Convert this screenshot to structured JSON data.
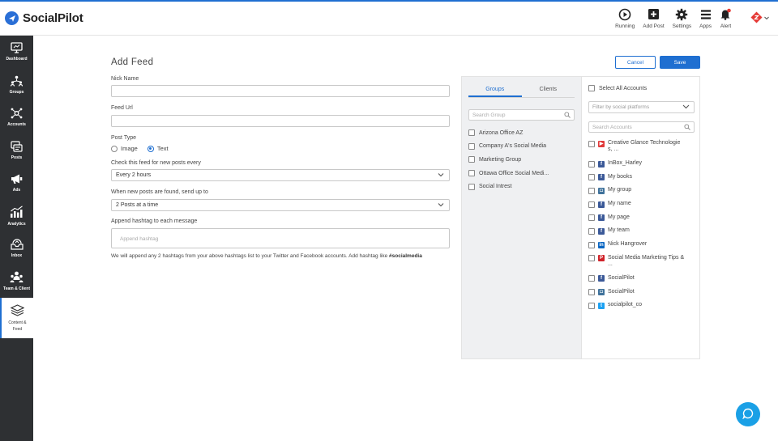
{
  "app": {
    "name": "SocialPilot"
  },
  "topbar": {
    "actions": [
      {
        "label": "Running",
        "icon": "play-icon"
      },
      {
        "label": "Add Post",
        "icon": "add-post-icon"
      },
      {
        "label": "Settings",
        "icon": "gear-icon"
      },
      {
        "label": "Apps",
        "icon": "menu-icon"
      },
      {
        "label": "Alert",
        "icon": "bell-icon"
      }
    ]
  },
  "sidebar": {
    "items": [
      {
        "label": "Dashboard",
        "icon": "dashboard-icon"
      },
      {
        "label": "Groups",
        "icon": "groups-icon"
      },
      {
        "label": "Accounts",
        "icon": "accounts-icon"
      },
      {
        "label": "Posts",
        "icon": "posts-icon"
      },
      {
        "label": "Ads",
        "icon": "megaphone-icon"
      },
      {
        "label": "Analytics",
        "icon": "analytics-icon"
      },
      {
        "label": "Inbox",
        "icon": "inbox-icon"
      },
      {
        "label": "Team & Client",
        "icon": "team-icon"
      },
      {
        "label": "Content & Feed",
        "line1": "Content &",
        "line2": "Feed",
        "icon": "layers-icon",
        "active": true
      }
    ]
  },
  "form": {
    "title": "Add Feed",
    "nick_label": "Nick Name",
    "nick_value": "",
    "feed_url_label": "Feed Url",
    "feed_url_value": "",
    "post_type_label": "Post Type",
    "post_type_options": [
      "Image",
      "Text"
    ],
    "post_type_selected": "Text",
    "check_label": "Check this feed for new posts every",
    "check_value": "Every 2 hours",
    "send_label": "When new posts are found, send up to",
    "send_value": "2 Posts at a time",
    "hashtag_label": "Append hashtag to each message",
    "hashtag_placeholder": "Append hashtag",
    "note_text": "We will append any 2 hashtags from your above hashtags list to your Twitter and Facebook accounts. Add hashtag like ",
    "note_bold": "#socialmedia"
  },
  "buttons": {
    "cancel": "Cancel",
    "save": "Save"
  },
  "groups_panel": {
    "tabs": [
      "Groups",
      "Clients"
    ],
    "active_tab": "Groups",
    "search_placeholder": "Search Group",
    "groups": [
      "Arizona Office AZ",
      "Company A's Social Media",
      "Marketing Group",
      "Ottawa Office Social Medi...",
      "Social Intrest"
    ]
  },
  "accounts_panel": {
    "select_all": "Select All Accounts",
    "filter_placeholder": "Filter by social platforms",
    "search_placeholder": "Search Accounts",
    "accounts": [
      {
        "name": "Creative Glance Technologie s, ...",
        "platform": "youtube"
      },
      {
        "name": "InBox_Harley",
        "platform": "facebook"
      },
      {
        "name": "My books",
        "platform": "facebook"
      },
      {
        "name": "My group",
        "platform": "instagram"
      },
      {
        "name": "My name",
        "platform": "facebook"
      },
      {
        "name": "My page",
        "platform": "facebook"
      },
      {
        "name": "My team",
        "platform": "facebook"
      },
      {
        "name": "Nick Hangrover",
        "platform": "linkedin"
      },
      {
        "name": "Social Media Marketing Tips & ...",
        "platform": "pinterest"
      },
      {
        "name": "SocialPilot",
        "platform": "facebook"
      },
      {
        "name": "SocialPilot",
        "platform": "instagram"
      },
      {
        "name": "socialpilot_co",
        "platform": "twitter"
      }
    ]
  },
  "colors": {
    "accent": "#1f6fd1",
    "sidebar_bg": "#2e3033",
    "chat": "#1aa0e6"
  }
}
